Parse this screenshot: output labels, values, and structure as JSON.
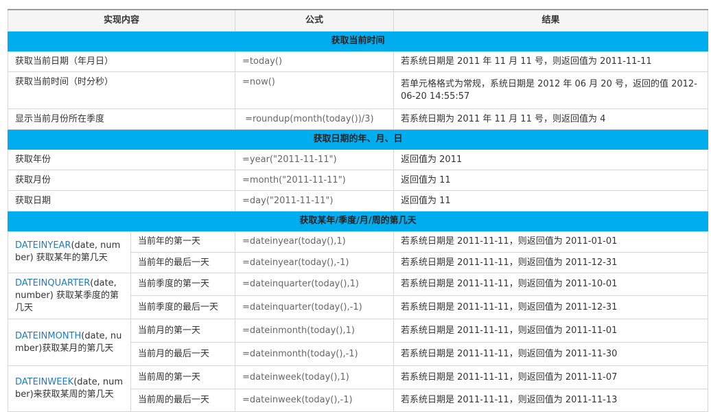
{
  "headers": [
    "实现内容",
    "公式",
    "结果"
  ],
  "sections": [
    {
      "title": "获取当前时间",
      "rows": [
        {
          "label": "获取当前日期（年月日）",
          "formula": "=today()",
          "result": "若系统日期是 2011 年 11 月 11 号，则返回值为 2011-11-11"
        },
        {
          "label": "获取当前时间（时分秒）",
          "formula": "=now()",
          "result": "若单元格格式为常规，系统日期是 2012 年 06 月 20 号，返回的值 2012-06-20 14:55:57"
        },
        {
          "label": "显示当前月份所在季度",
          "formula": " =roundup(month(today())/3)",
          "result": "若系统日期为 2011 年 11 月 11 号，则返回值为 4"
        }
      ]
    },
    {
      "title": "获取日期的年、月、日",
      "rows": [
        {
          "label": "获取年份",
          "formula": "=year(\"2011-11-11\")",
          "result": "返回值为 2011"
        },
        {
          "label": "获取月份",
          "formula": "=month(\"2011-11-11\")",
          "result": "返回值为 11"
        },
        {
          "label": "获取日期",
          "formula": "=day(\"2011-11-11\")",
          "result": "返回值为 11"
        }
      ]
    },
    {
      "title": "获取某年/季度/月/周的第几天",
      "groups": [
        {
          "fn": "DATEINYEAR",
          "desc": "(date, number) 获取某年的第几天",
          "rows": [
            {
              "label": "当前年的第一天",
              "formula": "=dateinyear(today(),1)",
              "result": "若系统日期是 2011-11-11，则返回值为 2011-01-01"
            },
            {
              "label": "当前年的最后一天",
              "formula": "=dateinyear(today(),-1)",
              "result": "若系统日期是 2011-11-11，则返回值为 2011-12-31"
            }
          ]
        },
        {
          "fn": "DATEINQUARTER",
          "desc": "(date, number) 获取某季度的第几天",
          "rows": [
            {
              "label": "当前季度的第一天",
              "formula": "=dateinquarter(today(),1)",
              "result": "若系统日期是 2011-11-11，则返回值为 2011-10-01"
            },
            {
              "label": "当前季度的最后一天",
              "formula": "=dateinquarter(today(),-1)",
              "result": "若系统日期是 2011-11-11，则返回值为 2011-12-31"
            }
          ]
        },
        {
          "fn": "DATEINMONTH",
          "desc": "(date, number)获取某月的第几天",
          "rows": [
            {
              "label": "当前月的第一天",
              "formula": "=dateinmonth(today(),1)",
              "result": "若系统日期是 2011-11-11，则返回值为 2011-11-01"
            },
            {
              "label": "当前月的最后一天",
              "formula": "=dateinmonth(today(),-1)",
              "result": "若系统日期是 2011-11-11，则返回值为 2011-11-30"
            }
          ]
        },
        {
          "fn": "DATEINWEEK",
          "desc": "(date, number)来获取某周的第几天",
          "rows": [
            {
              "label": "当前周的第一天",
              "formula": "=dateinweek(today(),1)",
              "result": "若系统日期是 2011-11-11，则返回值为 2011-11-07"
            },
            {
              "label": "当前周的最后一天",
              "formula": "=dateinweek(today(),-1)",
              "result": "若系统日期是 2011-11-11，则返回值为 2011-11-13"
            }
          ]
        }
      ]
    }
  ]
}
